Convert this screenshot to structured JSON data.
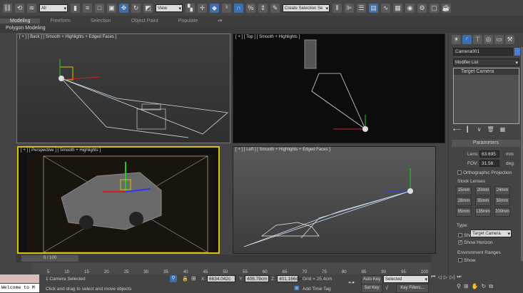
{
  "toolbar": {
    "selection_filter": "All",
    "ref_coord": "View",
    "named_selection": "Create Selection Se",
    "icons": [
      "link-icon",
      "unlink-icon",
      "bind-space-warp-icon",
      "select-object-icon",
      "select-by-name-icon",
      "rect-selection-icon",
      "window-crossing-icon",
      "select-move-icon",
      "select-rotate-icon",
      "select-scale-icon",
      "pivot-icon",
      "move-icon",
      "manipulate-icon",
      "snap-icon",
      "angle-snap-icon",
      "percent-snap-icon",
      "spinner-snap-icon",
      "edit-named-sel-icon",
      "mirror-icon",
      "align-icon",
      "layer-icon",
      "graphite-icon",
      "curve-editor-icon",
      "schematic-icon",
      "material-editor-icon",
      "render-setup-icon",
      "render-frame-icon",
      "render-icon"
    ]
  },
  "ribbon": {
    "tabs": [
      "Modeling",
      "Freeform",
      "Selection",
      "Object Paint",
      "Populate"
    ],
    "active": "Modeling",
    "panel": "Polygon Modeling"
  },
  "viewports": {
    "back": "[ + ] [ Back ] [ Smooth + Highlights + Edged Faces ]",
    "top": "[ + ] [ Top ] [ Smooth + Highlights ]",
    "perspective": "[ + ] [ Perspective ] [ Smooth + Highlights ]",
    "left": "[ + ] [ Left ] [ Smooth + Highlights + Edged Faces ]"
  },
  "command_panel": {
    "object_name": "Camera001",
    "object_color": "#4a7fd6",
    "modifier_list": "Modifier List",
    "stack": [
      "Target Camera"
    ],
    "rollout": "Parameters",
    "lens_label": "Lens:",
    "lens": "63.695",
    "lens_unit": "mm",
    "fov_label": "FOV:",
    "fov": "31.56",
    "fov_unit": "deg.",
    "ortho": "Orthographic Projection",
    "stock_lenses": "Stock Lenses",
    "lenses": [
      "15mm",
      "20mm",
      "24mm",
      "28mm",
      "35mm",
      "50mm",
      "85mm",
      "135mm",
      "200mm"
    ],
    "type_label": "Type:",
    "type": "Target Camera",
    "show_cone": "Show Cone",
    "show_horizon": "Show Horizon",
    "env_ranges": "Environment Ranges",
    "show": "Show"
  },
  "timeline": {
    "position": "0 / 100",
    "current": 0,
    "max": 100,
    "ticks": [
      "5",
      "10",
      "15",
      "20",
      "25",
      "30",
      "35",
      "40",
      "45",
      "50",
      "55",
      "60",
      "65",
      "70",
      "75",
      "80",
      "85",
      "90",
      "95",
      "100"
    ]
  },
  "status": {
    "maxscript": "Welcome to M",
    "selected": "1 Camera Selected",
    "prompt": "Click and drag to select and move objects",
    "x_label": "X:",
    "x": "6634.042c",
    "y_label": "Y:",
    "y": "408.78cm",
    "z_label": "Z:",
    "z": "401.166cm",
    "grid": "Grid = 25.4cm",
    "add_time_tag": "Add Time Tag",
    "auto_key": "Auto Key",
    "set_key": "Set Key",
    "key_mode": "Selected",
    "key_filters": "Key Filters..."
  }
}
